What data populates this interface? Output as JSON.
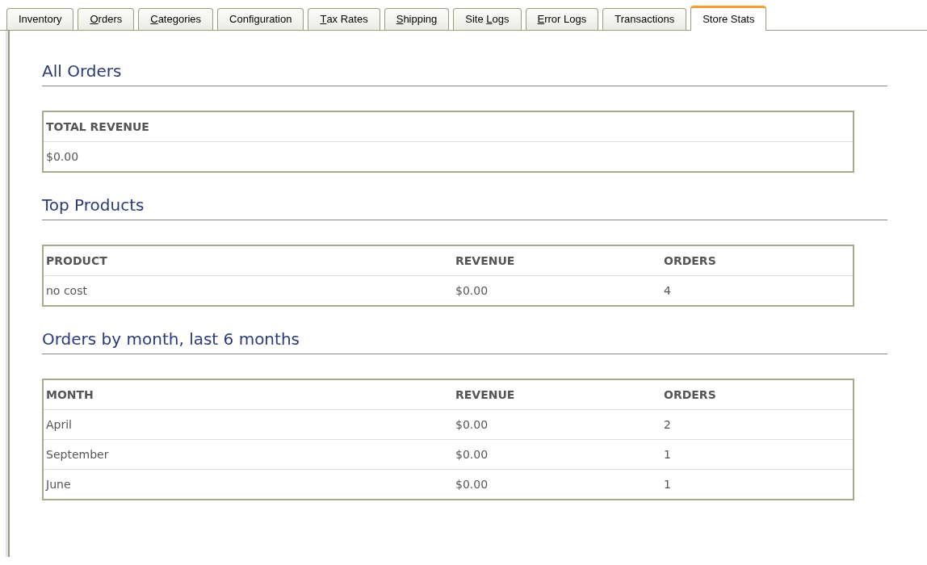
{
  "tabs": [
    {
      "before": "Inventory",
      "selected": false
    },
    {
      "key": "O",
      "after": "rders",
      "selected": false
    },
    {
      "key": "C",
      "after": "ategories",
      "selected": false
    },
    {
      "before": "Configuration",
      "selected": false
    },
    {
      "key": "T",
      "after": "ax Rates",
      "selected": false
    },
    {
      "key": "S",
      "after": "hipping",
      "selected": false
    },
    {
      "before": "Site ",
      "key": "L",
      "after": "ogs",
      "selected": false
    },
    {
      "key": "E",
      "after": "rror Logs",
      "selected": false
    },
    {
      "before": "Transactions",
      "selected": false
    },
    {
      "before": "Store Stats",
      "selected": true
    }
  ],
  "sections": [
    {
      "heading": "All Orders",
      "table": {
        "columns": [
          "TOTAL REVENUE"
        ],
        "rows": [
          [
            "$0.00"
          ]
        ]
      }
    },
    {
      "heading": "Top Products",
      "table": {
        "columns": [
          "PRODUCT",
          "REVENUE",
          "ORDERS"
        ],
        "rows": [
          [
            "no cost",
            "$0.00",
            "4"
          ]
        ]
      }
    },
    {
      "heading": "Orders by month, last 6 months",
      "table": {
        "columns": [
          "MONTH",
          "REVENUE",
          "ORDERS"
        ],
        "rows": [
          [
            "April",
            "$0.00",
            "2"
          ],
          [
            "September",
            "$0.00",
            "1"
          ],
          [
            "June",
            "$0.00",
            "1"
          ]
        ]
      }
    }
  ]
}
